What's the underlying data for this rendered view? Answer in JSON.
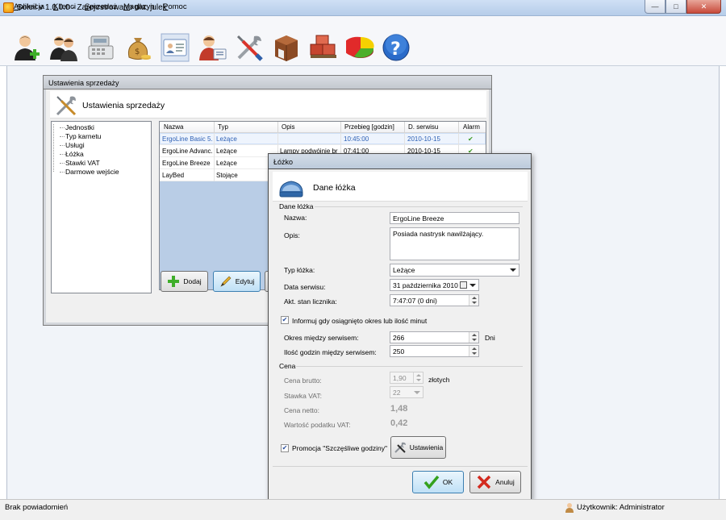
{
  "window": {
    "title": "Soleil  v 1.0.0.0 - Zarejestrowano dla: julek",
    "minimize_label": "—",
    "maximize_label": "□",
    "close_label": "✕"
  },
  "menu": {
    "items": [
      {
        "label": "Aplikacja",
        "hotkey": "A",
        "rest": "plikacja"
      },
      {
        "label": "Klienci",
        "hotkey": "K",
        "rest": "lienci"
      },
      {
        "label": "Sprzedaż",
        "hotkey": "S",
        "rest": "przedaż"
      },
      {
        "label": "Magazyn",
        "hotkey": "M",
        "rest": "agazyn"
      },
      {
        "label": "Pomoc",
        "hotkey": "P",
        "rest": "omoc"
      }
    ]
  },
  "toolbar": {
    "icons": [
      "add-client-icon",
      "clients-icon",
      "cash-register-icon",
      "money-bag-icon",
      "id-card-icon",
      "user-card-icon",
      "tools-icon",
      "warehouse-box-icon",
      "boxes-icon",
      "pie-chart-icon",
      "help-icon"
    ]
  },
  "settings_dialog": {
    "title": "Ustawienia sprzedaży",
    "header": "Ustawienia sprzedaży",
    "tree": [
      "Jednostki",
      "Typ karnetu",
      "Usługi",
      "Łóżka",
      "Stawki VAT",
      "Darmowe wejście"
    ],
    "columns": [
      "Nazwa",
      "Typ",
      "Opis",
      "Przebieg [godzin]",
      "D. serwisu",
      "Alarm"
    ],
    "rows": [
      [
        "ErgoLine Basic 5...",
        "Leżące",
        "",
        "10:45:00",
        "2010-10-15",
        "✔"
      ],
      [
        "ErgoLine Advanc...",
        "Leżące",
        "Lampy podwójnie bra...",
        "07:41:00",
        "2010-10-15",
        "✔"
      ],
      [
        "ErgoLine Breeze",
        "Leżące",
        "",
        "",
        "",
        ""
      ],
      [
        "LayBed",
        "Stojące",
        "",
        "",
        "",
        ""
      ]
    ],
    "add_label": "Dodaj",
    "edit_label": "Edytuj"
  },
  "bed_dialog": {
    "title": "Łóżko",
    "header": "Dane łóżka",
    "section_data": "Dane łóżka",
    "name_label": "Nazwa:",
    "name_value": "ErgoLine Breeze",
    "desc_label": "Opis:",
    "desc_value": "Posiada nastrysk nawilżający.",
    "type_label": "Typ łóżka:",
    "type_value": "Leżące",
    "service_date_label": "Data serwisu:",
    "service_date_value": "31 października 2010",
    "counter_label": "Akt. stan licznika:",
    "counter_value": "7:47:07 (0 dni)",
    "notify_label": "Informuj gdy osiągnięto okres lub ilość minut",
    "notify_checked": true,
    "period_label": "Okres między serwisem:",
    "period_value": "266",
    "period_unit": "Dni",
    "hours_label": "Ilość godzin między serwisem:",
    "hours_value": "250",
    "section_price": "Cena",
    "gross_label": "Cena brutto:",
    "gross_value": "1,90",
    "gross_unit": "złotych",
    "vat_label": "Stawka VAT:",
    "vat_value": "22",
    "net_label": "Cena netto:",
    "net_value": "1,48",
    "vat_amount_label": "Wartość podatku VAT:",
    "vat_amount_value": "0,42",
    "promo_label": "Promocja \"Szczęśliwe godziny\"",
    "promo_checked": true,
    "promo_settings_label": "Ustawienia",
    "ok_label": "OK",
    "cancel_label": "Anuluj"
  },
  "status": {
    "left": "Brak powiadomień",
    "right": "Użytkownik: Administrator"
  },
  "colors": {
    "titlebar": "#c6d8ee",
    "selection_text": "#2d5fb4",
    "grid_empty": "#b9cde6",
    "close_button": "#c8493a"
  }
}
